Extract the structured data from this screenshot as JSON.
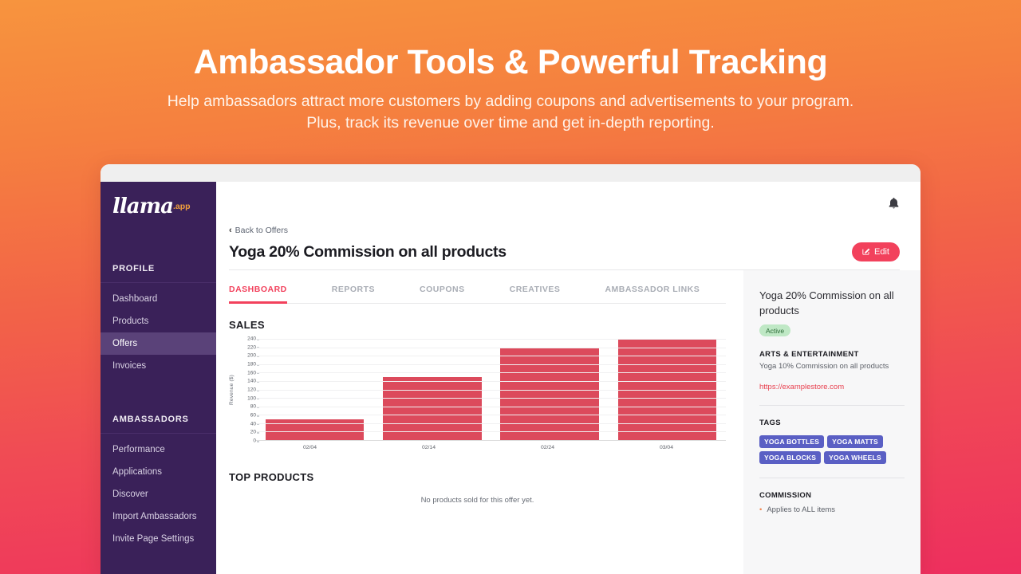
{
  "promo": {
    "title": "Ambassador Tools & Powerful Tracking",
    "subtitle": "Help ambassadors attract more customers by adding coupons and advertisements to your program. Plus, track its revenue over time and get in-depth reporting."
  },
  "brand": {
    "logo_text": "llama",
    "logo_suffix": ".app",
    "accent": "#F2415C",
    "sidebar_bg": "#3A2159",
    "sidebar_active_bg": "#5A4279",
    "bar_color": "#DC4A5C",
    "tag_color": "#5A5FC4",
    "link_color": "#E8404F",
    "gradient_from": "#F7943E",
    "gradient_to": "#EE2F5F"
  },
  "sidebar": {
    "sections": [
      {
        "label": "PROFILE",
        "items": [
          {
            "label": "Dashboard",
            "active": false
          },
          {
            "label": "Products",
            "active": false
          },
          {
            "label": "Offers",
            "active": true
          },
          {
            "label": "Invoices",
            "active": false
          }
        ]
      },
      {
        "label": "AMBASSADORS",
        "items": [
          {
            "label": "Performance",
            "active": false
          },
          {
            "label": "Applications",
            "active": false
          },
          {
            "label": "Discover",
            "active": false
          },
          {
            "label": "Import Ambassadors",
            "active": false
          },
          {
            "label": "Invite Page Settings",
            "active": false
          }
        ]
      }
    ]
  },
  "topbar": {
    "notification_icon": "bell-icon"
  },
  "header": {
    "back_label": "Back to Offers",
    "back_chevron": "‹",
    "title": "Yoga 20% Commission on all products",
    "edit_label": "Edit",
    "edit_icon": "pencil-square-icon"
  },
  "tabs": [
    {
      "label": "DASHBOARD",
      "active": true
    },
    {
      "label": "REPORTS",
      "active": false
    },
    {
      "label": "COUPONS",
      "active": false
    },
    {
      "label": "CREATIVES",
      "active": false
    },
    {
      "label": "AMBASSADOR LINKS",
      "active": false
    }
  ],
  "sales": {
    "heading": "SALES"
  },
  "top_products": {
    "heading": "TOP PRODUCTS",
    "empty_message": "No products sold for this offer yet."
  },
  "offer_panel": {
    "title": "Yoga 20% Commission on all products",
    "status": "Active",
    "category_label": "ARTS & ENTERTAINMENT",
    "description": "Yoga 10% Commission on all products",
    "url": "https://examplestore.com",
    "tags_label": "TAGS",
    "tags": [
      "YOGA BOTTLES",
      "YOGA MATTS",
      "YOGA BLOCKS",
      "YOGA WHEELS"
    ],
    "commission_label": "COMMISSION",
    "commission_items": [
      "Applies to ALL items"
    ]
  },
  "chart_data": {
    "type": "bar",
    "title": "SALES",
    "xlabel": "",
    "ylabel": "Revenue ($)",
    "categories": [
      "02/04",
      "02/14",
      "02/24",
      "03/04"
    ],
    "values": [
      50,
      150,
      220,
      240
    ],
    "ylim": [
      0,
      240
    ],
    "yticks": [
      0,
      20,
      40,
      60,
      80,
      100,
      120,
      140,
      160,
      180,
      200,
      220,
      240
    ],
    "grid": true,
    "legend": false,
    "series_color": "#DC4A5C"
  }
}
